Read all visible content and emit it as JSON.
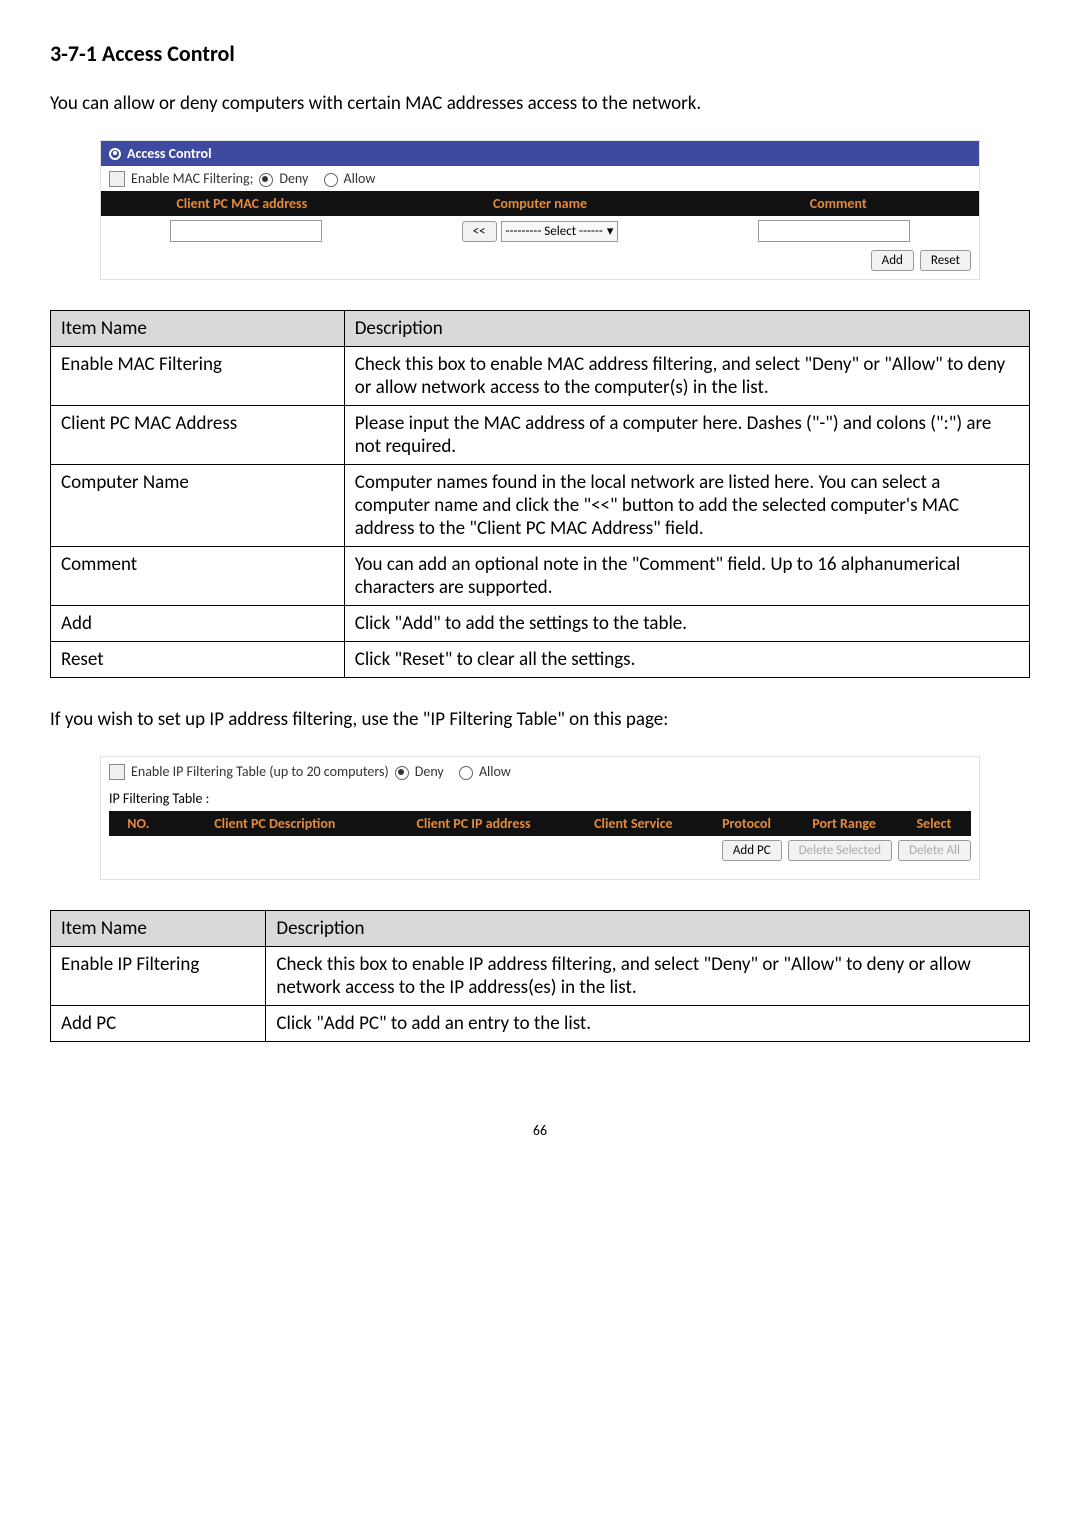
{
  "heading": "3-7-1 Access Control",
  "intro": "You can allow or deny computers with certain MAC addresses access to the network.",
  "access_panel": {
    "title": "Access Control",
    "enable_label_prefix": "Enable MAC Filtering; ",
    "deny": "Deny",
    "allow": "Allow",
    "col_mac": "Client PC MAC address",
    "col_name": "Computer name",
    "col_comment": "Comment",
    "select_placeholder": "--------- Select ------",
    "lt_btn": "<<",
    "add_btn": "Add",
    "reset_btn": "Reset"
  },
  "table1": {
    "h1": "Item Name",
    "h2": "Description",
    "rows": [
      {
        "name": "Enable MAC Filtering",
        "desc": "Check this box to enable MAC address filtering, and select \"Deny\" or \"Allow\" to deny or allow network access to the computer(s) in the list."
      },
      {
        "name": "Client PC MAC Address",
        "desc": "Please input the MAC address of a computer here. Dashes (\"-\") and colons (\":\") are not required."
      },
      {
        "name": "Computer Name",
        "desc": "Computer names found in the local network are listed here. You can select a computer name and click the \"<<\" button to add the selected computer's MAC address to the \"Client PC MAC Address\" field."
      },
      {
        "name": "Comment",
        "desc": "You can add an optional note in the \"Comment\" field. Up to 16 alphanumerical characters are supported."
      },
      {
        "name": "Add",
        "desc": "Click \"Add\" to add the settings to the table."
      },
      {
        "name": "Reset",
        "desc": "Click \"Reset\" to clear all the settings."
      }
    ]
  },
  "mid_sentence": "If you wish to set up IP address filtering, use the \"IP Filtering Table\" on this page:",
  "ip_panel": {
    "enable_label": "Enable IP Filtering Table (up to 20 computers) ",
    "deny": "Deny",
    "allow": "Allow",
    "table_label": "IP Filtering Table :",
    "col_no": "NO.",
    "col_desc": "Client PC Description",
    "col_ip": "Client PC IP address",
    "col_service": "Client Service",
    "col_proto": "Protocol",
    "col_port": "Port Range",
    "col_select": "Select",
    "add_pc": "Add PC",
    "del_sel": "Delete Selected",
    "del_all": "Delete All"
  },
  "table2": {
    "h1": "Item Name",
    "h2": "Description",
    "rows": [
      {
        "name": "Enable IP Filtering",
        "desc": "Check this box to enable IP address filtering, and select \"Deny\" or \"Allow\" to deny or allow network access to the IP address(es) in the list."
      },
      {
        "name": "Add PC",
        "desc": "Click \"Add PC\" to add an entry to the list."
      }
    ]
  },
  "page_num": "66"
}
